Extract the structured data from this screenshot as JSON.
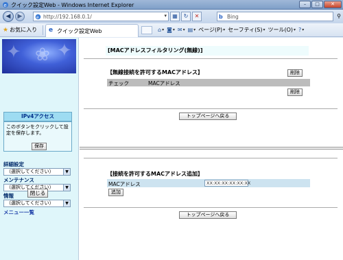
{
  "window": {
    "title": "クイック設定Web - Windows Internet Explorer",
    "min": "–",
    "max": "□",
    "close": "✕"
  },
  "address": {
    "url": "http://192.168.0.1/",
    "search_placeholder": "Bing"
  },
  "favbar": {
    "favorites_label": "お気に入り",
    "tab_label": "クイック設定Web",
    "commands": [
      {
        "icon": "home-icon",
        "glyph": "⌂",
        "label": ""
      },
      {
        "icon": "feeds-icon",
        "glyph": "◙",
        "label": ""
      },
      {
        "icon": "mail-icon",
        "glyph": "✉",
        "label": ""
      },
      {
        "icon": "print-icon",
        "glyph": "▤",
        "label": ""
      },
      {
        "icon": "page-icon",
        "glyph": "",
        "label": "ページ(P)"
      },
      {
        "icon": "safety-icon",
        "glyph": "",
        "label": "セーフティ(S)"
      },
      {
        "icon": "tools-icon",
        "glyph": "",
        "label": "ツール(O)"
      },
      {
        "icon": "help-icon",
        "glyph": "?",
        "label": ""
      }
    ]
  },
  "sidebar": {
    "ipv4_header": "IPv4アクセス",
    "ipv4_message": "このボタンをクリックして設定を保存します。",
    "save_label": "保存",
    "groups": [
      {
        "label": "詳細設定",
        "select": "（選択してください）"
      },
      {
        "label": "メンテナンス",
        "select": "（選択してください）"
      },
      {
        "label": "情報",
        "select": "（選択してください）"
      }
    ],
    "menu_link": "メニュー一覧",
    "close_label": "閉じる"
  },
  "main": {
    "page_heading": "[MACアドレスフィルタリング(無線)]",
    "allowed_title": "【無線接続を許可するMACアドレス】",
    "delete_label": "削除",
    "table_headers": [
      "チェック",
      "MACアドレス"
    ],
    "back_label": "トップページへ戻る",
    "add_title": "【接続を許可するMACアドレス追加】",
    "mac_label": "MACアドレス",
    "mac_value": "XX:XX:XX:XX:XX:XX",
    "add_label": "追加"
  }
}
